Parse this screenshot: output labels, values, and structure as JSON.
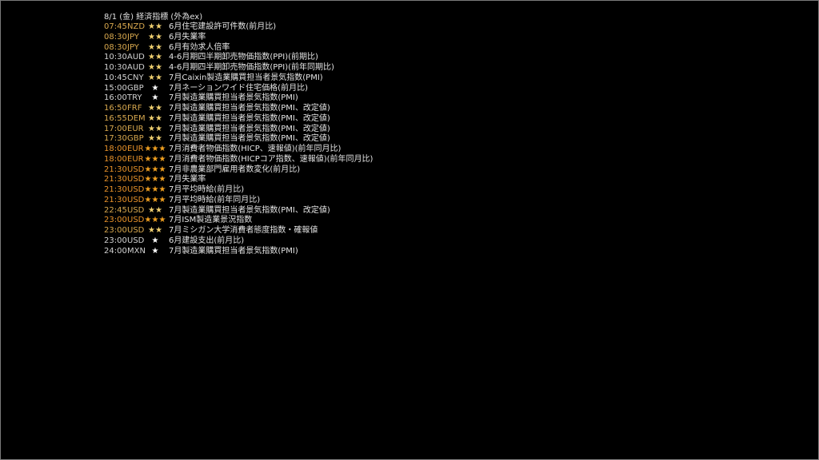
{
  "calendar": {
    "title": "8/1 (金) 経済指標 (外為ex)",
    "colors": {
      "time_gray": "#d2d2d2",
      "time_gold": "#d8a84e",
      "time_orange": "#e8922a",
      "star_two": "#f0d070",
      "star_one": "#ffffff",
      "star_three": "#f0a020"
    },
    "events": [
      {
        "time": "07:45",
        "ccy": "NZD",
        "stars": "★★",
        "desc": "6月住宅建設許可件数(前月比)",
        "tone": "gold",
        "level": 2
      },
      {
        "time": "08:30",
        "ccy": "JPY",
        "stars": "★★",
        "desc": "6月失業率",
        "tone": "gold",
        "level": 2
      },
      {
        "time": "08:30",
        "ccy": "JPY",
        "stars": "★★",
        "desc": "6月有効求人倍率",
        "tone": "gold",
        "level": 2
      },
      {
        "time": "10:30",
        "ccy": "AUD",
        "stars": "★★",
        "desc": "4-6月期四半期卸売物価指数(PPI)(前期比)",
        "tone": "gray",
        "level": 2
      },
      {
        "time": "10:30",
        "ccy": "AUD",
        "stars": "★★",
        "desc": "4-6月期四半期卸売物価指数(PPI)(前年同期比)",
        "tone": "gray",
        "level": 2
      },
      {
        "time": "10:45",
        "ccy": "CNY",
        "stars": "★★",
        "desc": "7月Caixin製造業購買担当者景気指数(PMI)",
        "tone": "gray",
        "level": 2
      },
      {
        "time": "15:00",
        "ccy": "GBP",
        "stars": "★",
        "desc": "7月ネーションワイド住宅価格(前月比)",
        "tone": "gray",
        "level": 1
      },
      {
        "time": "16:00",
        "ccy": "TRY",
        "stars": "★",
        "desc": "7月製造業購買担当者景気指数(PMI)",
        "tone": "gray",
        "level": 1
      },
      {
        "time": "16:50",
        "ccy": "FRF",
        "stars": "★★",
        "desc": "7月製造業購買担当者景気指数(PMI、改定値)",
        "tone": "gold",
        "level": 2
      },
      {
        "time": "16:55",
        "ccy": "DEM",
        "stars": "★★",
        "desc": "7月製造業購買担当者景気指数(PMI、改定値)",
        "tone": "gold",
        "level": 2
      },
      {
        "time": "17:00",
        "ccy": "EUR",
        "stars": "★★",
        "desc": "7月製造業購買担当者景気指数(PMI、改定値)",
        "tone": "gold",
        "level": 2
      },
      {
        "time": "17:30",
        "ccy": "GBP",
        "stars": "★★",
        "desc": "7月製造業購買担当者景気指数(PMI、改定値)",
        "tone": "gold",
        "level": 2
      },
      {
        "time": "18:00",
        "ccy": "EUR",
        "stars": "★★★",
        "desc": "7月消費者物価指数(HICP、速報値)(前年同月比)",
        "tone": "orange",
        "level": 3
      },
      {
        "time": "18:00",
        "ccy": "EUR",
        "stars": "★★★",
        "desc": "7月消費者物価指数(HICPコア指数、速報値)(前年同月比)",
        "tone": "orange",
        "level": 3
      },
      {
        "time": "21:30",
        "ccy": "USD",
        "stars": "★★★",
        "desc": "7月非農業部門雇用者数変化(前月比)",
        "tone": "orange",
        "level": 3
      },
      {
        "time": "21:30",
        "ccy": "USD",
        "stars": "★★★",
        "desc": "7月失業率",
        "tone": "orange",
        "level": 3
      },
      {
        "time": "21:30",
        "ccy": "USD",
        "stars": "★★★",
        "desc": "7月平均時給(前月比)",
        "tone": "orange",
        "level": 3
      },
      {
        "time": "21:30",
        "ccy": "USD",
        "stars": "★★★",
        "desc": "7月平均時給(前年同月比)",
        "tone": "orange",
        "level": 3
      },
      {
        "time": "22:45",
        "ccy": "USD",
        "stars": "★★",
        "desc": "7月製造業購買担当者景気指数(PMI、改定値)",
        "tone": "gold",
        "level": 2
      },
      {
        "time": "23:00",
        "ccy": "USD",
        "stars": "★★★",
        "desc": "7月ISM製造業景況指数",
        "tone": "orange",
        "level": 3
      },
      {
        "time": "23:00",
        "ccy": "USD",
        "stars": "★★",
        "desc": "7月ミシガン大学消費者態度指数・確報値",
        "tone": "gold",
        "level": 2
      },
      {
        "time": "23:00",
        "ccy": "USD",
        "stars": "★",
        "desc": "6月建設支出(前月比)",
        "tone": "gray",
        "level": 1
      },
      {
        "time": "24:00",
        "ccy": "MXN",
        "stars": "★",
        "desc": "7月製造業購買担当者景気指数(PMI)",
        "tone": "gray",
        "level": 1
      }
    ]
  }
}
